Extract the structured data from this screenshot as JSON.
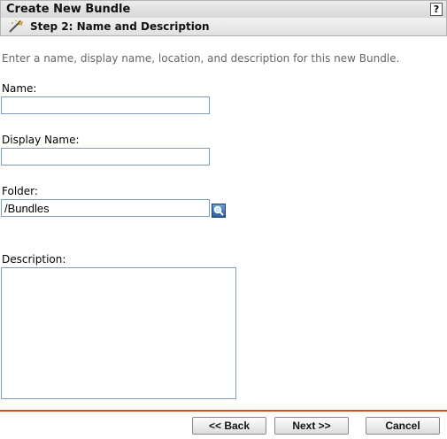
{
  "header": {
    "title": "Create New Bundle",
    "help_label": "?"
  },
  "step": {
    "title": "Step 2: Name and Description",
    "icon": "magic-wand-icon"
  },
  "intro": "Enter a name, display name, location, and description for this new Bundle.",
  "form": {
    "name_label": "Name:",
    "name_value": "",
    "display_name_label": "Display Name:",
    "display_name_value": "",
    "folder_label": "Folder:",
    "folder_value": "/Bundles",
    "browse_icon": "magnifier-icon",
    "description_label": "Description:",
    "description_value": ""
  },
  "buttons": {
    "back": "<< Back",
    "next": "Next >>",
    "cancel": "Cancel"
  },
  "colors": {
    "divider": "#d2521f",
    "field_border": "#7f9db9",
    "intro_text": "#666666"
  }
}
